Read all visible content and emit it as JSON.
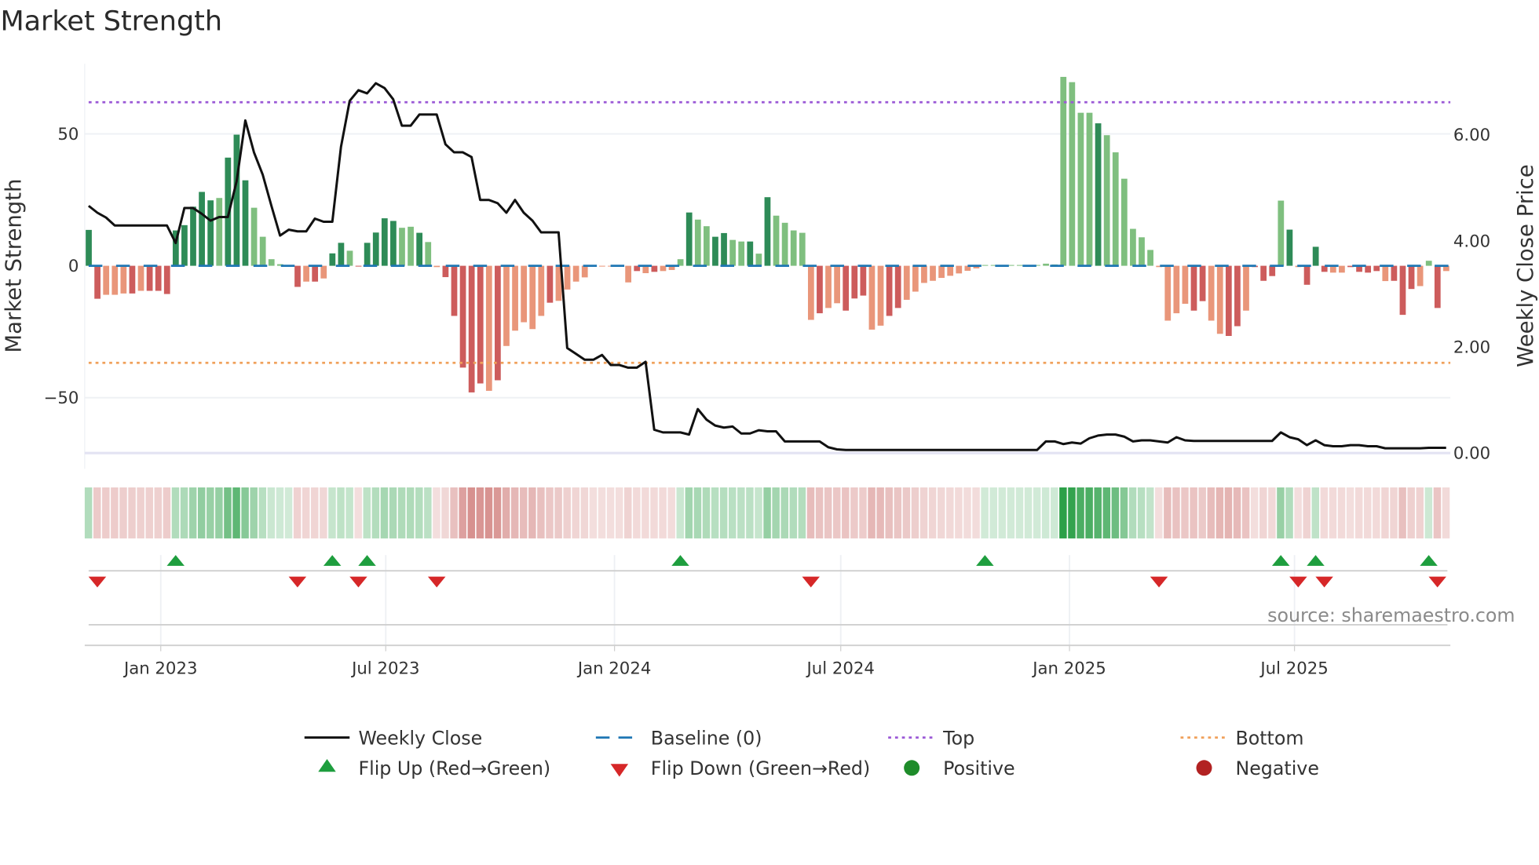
{
  "title": "Market Strength",
  "source": "source: sharemaestro.com",
  "colors": {
    "pos_dark": "#2e8b57",
    "pos_light": "#7fbf7f",
    "neg_dark": "#cd5c5c",
    "neg_light": "#e9967a",
    "heat_pos": "#2ca048",
    "heat_neg": "#c0504d",
    "baseline": "#1f77b4",
    "top": "#9b59d6",
    "bottom": "#f0a05a",
    "flip_up": "#1e9e3e",
    "flip_down": "#d62728",
    "positive": "#1e8c2a",
    "negative": "#b22222",
    "close": "#111111"
  },
  "chart_data": {
    "type": "bar+line",
    "title": "Market Strength",
    "ylabel": "Market Strength",
    "y2label": "Weekly Close Price",
    "ylim": [
      -77,
      77
    ],
    "y2lim": [
      -0.3,
      7.35
    ],
    "yticks": [
      {
        "v": 50,
        "label": "50"
      },
      {
        "v": 0,
        "label": "0"
      },
      {
        "v": -50,
        "label": "−50"
      }
    ],
    "y2ticks": [
      {
        "v": 6,
        "label": "6.00"
      },
      {
        "v": 4,
        "label": "4.00"
      },
      {
        "v": 2,
        "label": "2.00"
      },
      {
        "v": 0,
        "label": "0.00"
      }
    ],
    "xticks": [
      {
        "date": "2023-01-01",
        "label": "Jan 2023"
      },
      {
        "date": "2023-07-01",
        "label": "Jul 2023"
      },
      {
        "date": "2024-01-01",
        "label": "Jan 2024"
      },
      {
        "date": "2024-07-01",
        "label": "Jul 2024"
      },
      {
        "date": "2025-01-01",
        "label": "Jan 2025"
      },
      {
        "date": "2025-07-01",
        "label": "Jul 2025"
      }
    ],
    "start_date": "2022-11-04",
    "interval_days": 7,
    "top_level": 62,
    "bottom_level": -36.8,
    "baseline": 0,
    "strength": [
      13.6,
      -12.5,
      -11,
      -11,
      -10.5,
      -10.5,
      -9.5,
      -9.5,
      -9.5,
      -10.7,
      13.4,
      15.4,
      22.4,
      28,
      24.8,
      25.7,
      41,
      49.7,
      32.4,
      22,
      11,
      2.5,
      0.6,
      0.2,
      -8,
      -6,
      -6,
      -4.8,
      4.7,
      8.7,
      5.7,
      -0.2,
      8.7,
      12.6,
      18,
      17,
      14.4,
      14.8,
      12.5,
      9,
      -0.5,
      -4.3,
      -19,
      -38.6,
      -48,
      -44.6,
      -47.4,
      -43.4,
      -30.4,
      -24.6,
      -21.4,
      -24,
      -19,
      -14,
      -13.3,
      -9,
      -6,
      -4.4,
      -0.3,
      -0.3,
      -0.3,
      -0.3,
      -6.3,
      -2,
      -2.8,
      -2.3,
      -2,
      -1.6,
      2.5,
      20.2,
      17.5,
      15,
      11,
      12.4,
      9.8,
      9.2,
      9.2,
      4.6,
      26,
      19,
      16.3,
      13.4,
      12.5,
      -20.5,
      -18,
      -16,
      -14.2,
      -17,
      -12.4,
      -11.3,
      -24.2,
      -22.7,
      -19,
      -16,
      -12.9,
      -9.8,
      -6.5,
      -5.7,
      -4.6,
      -3.8,
      -2.9,
      -1.9,
      -1,
      0.3,
      0.3,
      0.3,
      0.3,
      0.3,
      0.3,
      0.3,
      0.8,
      0.5,
      71.6,
      69.6,
      58,
      58,
      54,
      49.5,
      43,
      33,
      14,
      10.8,
      6,
      -0.5,
      -20.8,
      -18,
      -14.4,
      -17,
      -13.4,
      -20.8,
      -25.8,
      -26.6,
      -22.9,
      -17,
      -0.5,
      -5.7,
      -3.9,
      24.7,
      13.7,
      -0.5,
      -7.2,
      7.2,
      -2.3,
      -2.6,
      -2.6,
      -0.5,
      -2.3,
      -2.6,
      -2,
      -5.8,
      -5.7,
      -18.6,
      -8.8,
      -7.7,
      1.9,
      -16,
      -2
    ],
    "tone": "ddllldlddddddddldddllllldldlddldddddlldlldddddldllllldllllllllldldllldllddlldldllllldlldddllddlllllllllllllllllllllldllllllllllddllddldddldldddllddddldddlldldldllddl",
    "close": [
      4.66,
      4.53,
      4.44,
      4.29,
      4.29,
      4.29,
      4.29,
      4.29,
      4.29,
      4.29,
      3.96,
      4.62,
      4.62,
      4.51,
      4.38,
      4.45,
      4.45,
      5.12,
      6.27,
      5.67,
      5.25,
      4.66,
      4.1,
      4.21,
      4.18,
      4.18,
      4.42,
      4.36,
      4.36,
      5.77,
      6.64,
      6.84,
      6.78,
      6.97,
      6.88,
      6.67,
      6.17,
      6.17,
      6.38,
      6.38,
      6.38,
      5.82,
      5.67,
      5.67,
      5.58,
      4.77,
      4.77,
      4.71,
      4.53,
      4.77,
      4.53,
      4.38,
      4.16,
      4.16,
      4.16,
      1.98,
      1.87,
      1.76,
      1.76,
      1.85,
      1.66,
      1.66,
      1.61,
      1.61,
      1.72,
      0.44,
      0.39,
      0.39,
      0.39,
      0.35,
      0.83,
      0.63,
      0.52,
      0.48,
      0.5,
      0.37,
      0.37,
      0.43,
      0.41,
      0.41,
      0.22,
      0.22,
      0.22,
      0.22,
      0.22,
      0.11,
      0.07,
      0.06,
      0.06,
      0.06,
      0.06,
      0.06,
      0.06,
      0.06,
      0.06,
      0.06,
      0.06,
      0.06,
      0.06,
      0.06,
      0.06,
      0.06,
      0.06,
      0.06,
      0.06,
      0.06,
      0.06,
      0.06,
      0.06,
      0.06,
      0.22,
      0.22,
      0.17,
      0.2,
      0.18,
      0.28,
      0.33,
      0.35,
      0.35,
      0.31,
      0.22,
      0.24,
      0.24,
      0.22,
      0.2,
      0.3,
      0.24,
      0.23,
      0.23,
      0.23,
      0.23,
      0.23,
      0.23,
      0.23,
      0.23,
      0.23,
      0.23,
      0.39,
      0.3,
      0.26,
      0.15,
      0.24,
      0.15,
      0.13,
      0.13,
      0.15,
      0.15,
      0.13,
      0.13,
      0.09,
      0.09,
      0.09,
      0.09,
      0.09,
      0.1,
      0.1,
      0.1
    ],
    "flip_up_weeks": [
      10,
      28,
      32,
      68,
      103,
      137,
      141,
      154
    ],
    "flip_down_weeks": [
      1,
      24,
      31,
      40,
      83,
      123,
      139,
      142,
      155
    ]
  },
  "legend": {
    "weekly_close": "Weekly Close",
    "baseline": "Baseline (0)",
    "top": "Top",
    "bottom": "Bottom",
    "flip_up": "Flip Up (Red→Green)",
    "flip_down": "Flip Down (Green→Red)",
    "positive": "Positive",
    "negative": "Negative"
  }
}
